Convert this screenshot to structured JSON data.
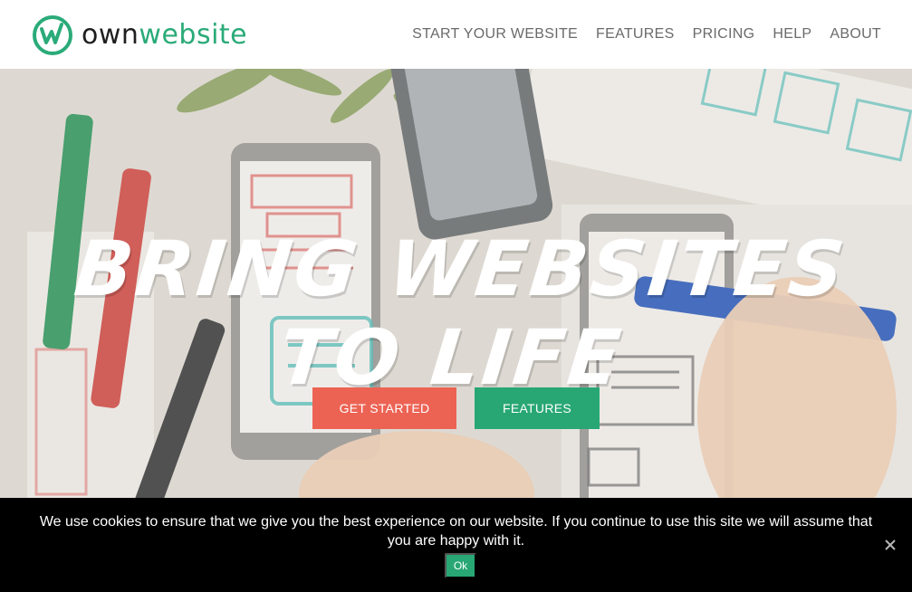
{
  "brand": {
    "name_part1": "own",
    "name_part2": "website",
    "logo_icon": "w-circle-logo-icon",
    "brand_color": "#2aab79"
  },
  "nav": {
    "items": [
      {
        "label": "START YOUR WEBSITE"
      },
      {
        "label": "FEATURES"
      },
      {
        "label": "PRICING"
      },
      {
        "label": "HELP"
      },
      {
        "label": "ABOUT"
      }
    ]
  },
  "hero": {
    "headline": "BRING WEBSITES TO LIFE",
    "get_started_label": "GET STARTED",
    "features_label": "FEATURES",
    "colors": {
      "get_started": "#ec6354",
      "features": "#28a774"
    }
  },
  "cookie_notice": {
    "text": "We use cookies to ensure that we give you the best experience on our website. If you continue to use this site we will assume that you are happy with it.",
    "ok_label": "Ok",
    "close_icon": "close-icon"
  }
}
